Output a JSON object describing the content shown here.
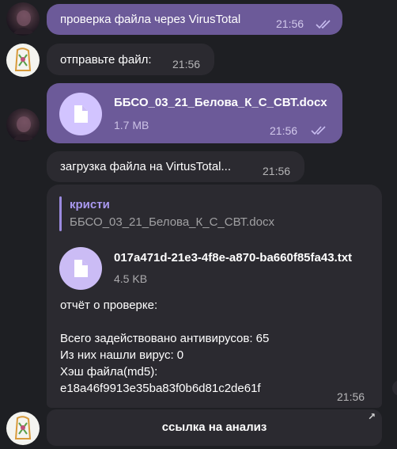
{
  "messages": {
    "m1": {
      "text": "проверка файла через VirusTotal",
      "time": "21:56"
    },
    "m2": {
      "text": "отправьте файл:",
      "time": "21:56"
    },
    "m3": {
      "file_name": "ББСО_03_21_Белова_К_С_СВТ.docx",
      "file_size": "1.7 MB",
      "time": "21:56"
    },
    "m4": {
      "text": "загрузка файла на VirtusTotal...",
      "time": "21:56"
    },
    "m5": {
      "quote_author": "кристи",
      "quote_text": "ББСО_03_21_Белова_К_С_СВТ.docx",
      "file_name": "017a471d-21e3-4f8e-a870-ba660f85fa43.txt",
      "file_size": "4.5 KB",
      "report": "отчёт о проверке:\n\nВсего задействовано антивирусов: 65\nИз них нашли вирус: 0\nХэш файла(md5):\ne18a46f9913e35ba83f0b6d81c2de61f",
      "time": "21:56"
    }
  },
  "inline_button": {
    "label": "ссылка на анализ",
    "icon": "external-link-arrow-icon"
  },
  "colors": {
    "background": "#1e1f23",
    "outgoing": "#6c5a99",
    "incoming": "#2b2a30",
    "accent": "#a999f0"
  }
}
